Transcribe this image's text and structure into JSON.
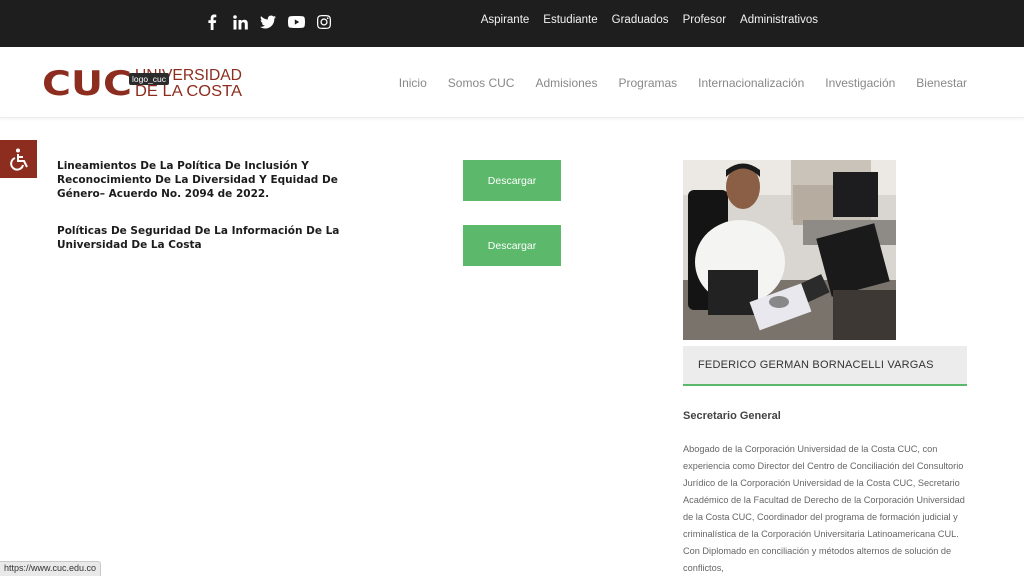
{
  "topbar": {
    "social_icons": [
      "facebook-icon",
      "linkedin-icon",
      "twitter-icon",
      "youtube-icon",
      "instagram-icon"
    ],
    "nav": [
      "Aspirante",
      "Estudiante",
      "Graduados",
      "Profesor",
      "Administrativos"
    ]
  },
  "header": {
    "logo_text": "CUC",
    "logo_line1": "UNIVERSIDAD",
    "logo_line2": "DE LA COSTA",
    "logo_tooltip": "logo_cuc",
    "nav": [
      "Inicio",
      "Somos CUC",
      "Admisiones",
      "Programas",
      "Internacionalización",
      "Investigación",
      "Bienestar"
    ]
  },
  "documents": [
    {
      "title": "Lineamientos De La Política De Inclusión Y Reconocimiento De La Diversidad Y Equidad De Género– Acuerdo No. 2094 de 2022.",
      "button": "Descargar"
    },
    {
      "title": "Políticas De Seguridad De La Información De La Universidad De La Costa",
      "button": "Descargar"
    }
  ],
  "profile": {
    "name": "FEDERICO GERMAN BORNACELLI VARGAS",
    "role": "Secretario General",
    "bio": "Abogado de la Corporación Universidad de la Costa CUC, con experiencia como Director del Centro de Conciliación del Consultorio Jurídico de la Corporación Universidad de la Costa CUC, Secretario Académico de la Facultad de Derecho de la Corporación Universidad de la Costa CUC, Coordinador del programa de formación judicial y criminalística de la Corporación Universitaria Latinoamericana CUL. Con Diplomado en conciliación y métodos alternos de solución de conflictos,"
  },
  "status_url": "https://www.cuc.edu.co",
  "colors": {
    "topbar": "#1e1e1e",
    "brand_red": "#8c2d1f",
    "button_green": "#5cb96b"
  }
}
